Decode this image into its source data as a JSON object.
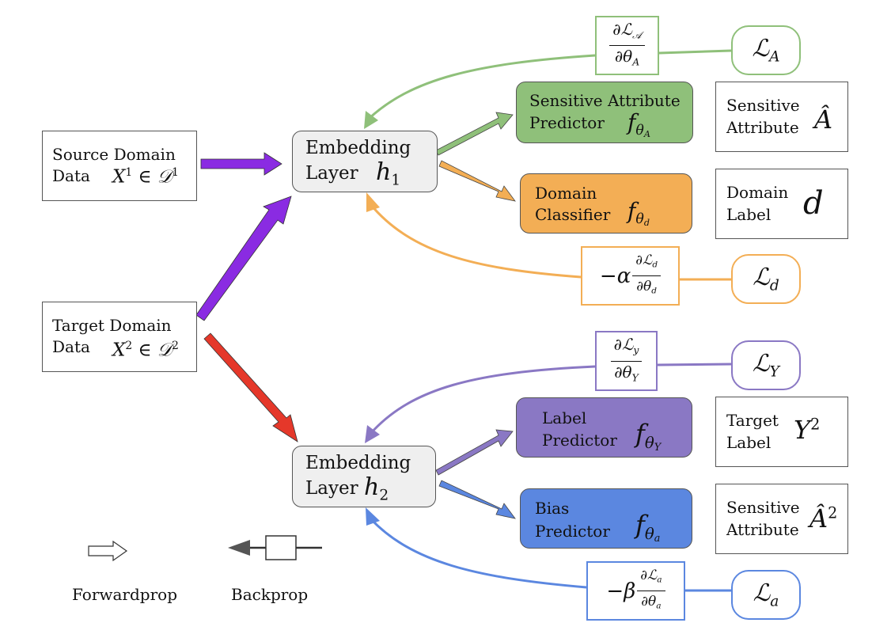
{
  "colors": {
    "sensitive": "#8fc07a",
    "domain": "#f3ae55",
    "label": "#8a78c4",
    "bias": "#5b87e0",
    "forward_source": "#8a2be2",
    "forward_target_bias": "#e5382a",
    "box_border": "#555555",
    "embedding_fill": "#efefef"
  },
  "inputs": {
    "source": {
      "line1": "Source Domain",
      "line2": "Data",
      "math_var": "X",
      "math_sup": "1",
      "math_in": "∈",
      "math_set": "𝒟",
      "math_set_sup": "1"
    },
    "target": {
      "line1": "Target Domain",
      "line2": "Data",
      "math_var": "X",
      "math_sup": "2",
      "math_in": "∈",
      "math_set": "𝒟",
      "math_set_sup": "2"
    }
  },
  "embeddings": {
    "h1": {
      "line1": "Embedding",
      "line2": "Layer",
      "var": "h",
      "sub": "1"
    },
    "h2": {
      "line1": "Embedding",
      "line2": "Layer",
      "var": "h",
      "sub": "2"
    }
  },
  "predictors": {
    "sensitive": {
      "line1": "Sensitive Attribute",
      "line2": "Predictor",
      "f": "f",
      "theta": "θ",
      "sub": "A"
    },
    "domain": {
      "line1": "Domain",
      "line2": "Classifier",
      "f": "f",
      "theta": "θ",
      "sub": "d"
    },
    "label": {
      "line1": "Label",
      "line2": "Predictor",
      "f": "f",
      "theta": "θ",
      "sub": "Y"
    },
    "bias": {
      "line1": "Bias",
      "line2": "Predictor",
      "f": "f",
      "theta": "θ",
      "sub": "a"
    }
  },
  "outputs": {
    "sensitive": {
      "line1": "Sensitive",
      "line2": "Attribute",
      "symbol": "Â",
      "sup": ""
    },
    "domain": {
      "line1": "Domain",
      "line2": "Label",
      "symbol": "d",
      "sup": ""
    },
    "label": {
      "line1": "Target",
      "line2": "Label",
      "symbol": "Y",
      "sup": "2"
    },
    "bias": {
      "line1": "Sensitive",
      "line2": "Attribute",
      "symbol": "Â",
      "sup": "2"
    }
  },
  "gradients": {
    "sensitive": {
      "prefix": "",
      "num": "∂ℒ",
      "num_sub": "𝒜",
      "den": "∂θ",
      "den_sub": "A"
    },
    "domain": {
      "prefix": "−α",
      "num": "∂ℒ",
      "num_sub": "d",
      "den": "∂θ",
      "den_sub": "d"
    },
    "label": {
      "prefix": "",
      "num": "∂ℒ",
      "num_sub": "y",
      "den": "∂θ",
      "den_sub": "Y"
    },
    "bias": {
      "prefix": "−β",
      "num": "∂ℒ",
      "num_sub": "a",
      "den": "∂θ",
      "den_sub": "a"
    }
  },
  "losses": {
    "sensitive": {
      "symbol": "ℒ",
      "sub": "A"
    },
    "domain": {
      "symbol": "ℒ",
      "sub": "d"
    },
    "label": {
      "symbol": "ℒ",
      "sub": "Y"
    },
    "bias": {
      "symbol": "ℒ",
      "sub": "a"
    }
  },
  "legend": {
    "forward": "Forwardprop",
    "backward": "Backprop"
  }
}
